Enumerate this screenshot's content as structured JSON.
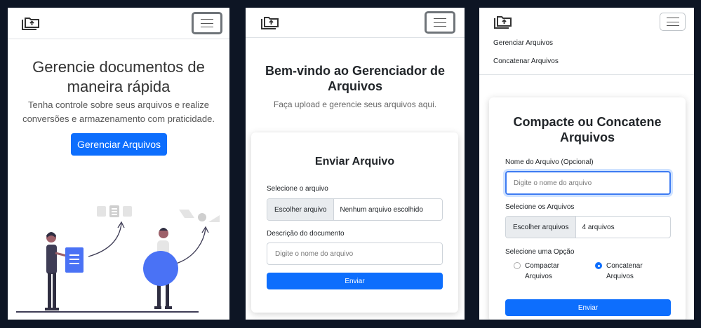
{
  "home": {
    "hero_title": "Gerencie documentos de maneira rápida",
    "hero_text": "Tenha controle sobre seus arquivos e realize conversões e armazenamento com praticidade.",
    "cta_label": "Gerenciar Arquivos"
  },
  "upload": {
    "welcome_title": "Bem-vindo ao Gerenciador de Arquivos",
    "welcome_sub": "Faça upload e gerencie seus arquivos aqui.",
    "card_title": "Enviar Arquivo",
    "file_label": "Selecione o arquivo",
    "file_button": "Escolher arquivo",
    "file_status": "Nenhum arquivo escolhido",
    "desc_label": "Descrição do documento",
    "desc_placeholder": "Digite o nome do arquivo",
    "submit_label": "Enviar"
  },
  "compress": {
    "menu": [
      "Gerenciar Arquivos",
      "Concatenar Arquivos"
    ],
    "card_title": "Compacte ou Concatene Arquivos",
    "name_label": "Nome do Arquivo (Opcional)",
    "name_placeholder": "Digite o nome do arquivo",
    "files_label": "Selecione os Arquivos",
    "files_button": "Escolher arquivos",
    "files_status": "4 arquivos",
    "option_label": "Selecione uma Opção",
    "options": [
      "Compactar Arquivos",
      "Concatenar Arquivos"
    ],
    "selected_option": "Concatenar Arquivos",
    "submit_label": "Enviar"
  },
  "icons": {
    "logo": "folder-upload-icon",
    "menu": "hamburger-menu-icon"
  },
  "colors": {
    "primary": "#0d6efd",
    "background": "#0d1524"
  }
}
